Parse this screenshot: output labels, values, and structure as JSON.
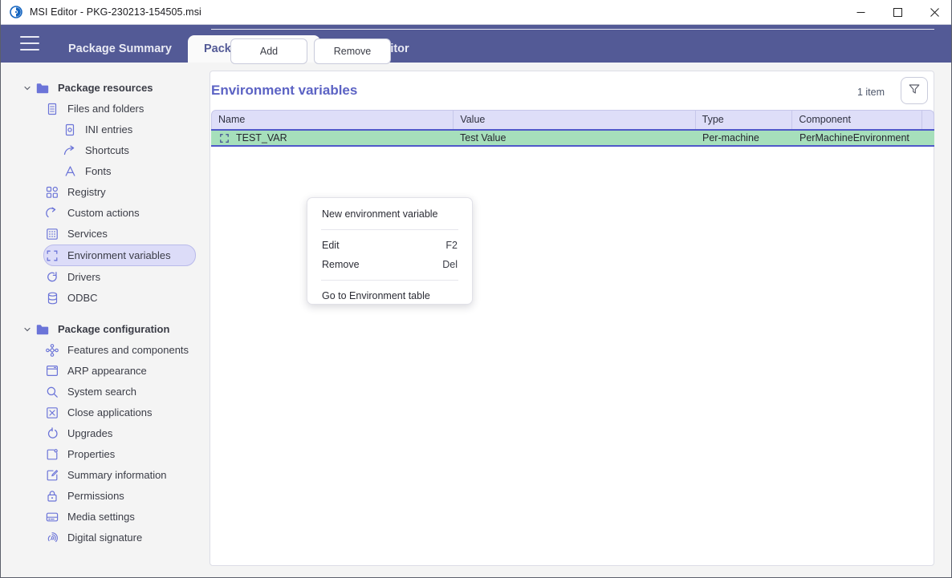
{
  "window": {
    "title": "MSI Editor - PKG-230213-154505.msi",
    "app_icon": "msi-editor-logo-icon",
    "controls": [
      {
        "name": "minimize",
        "icon": "minimize-icon"
      },
      {
        "name": "maximize",
        "icon": "maximize-icon"
      },
      {
        "name": "close",
        "icon": "close-icon"
      }
    ]
  },
  "tabbar": {
    "menu_icon": "hamburger-menu-icon",
    "tabs": [
      {
        "label": "Package Summary",
        "active": false
      },
      {
        "label": "Package Designer",
        "active": true
      },
      {
        "label": "Tables Editor",
        "active": false
      }
    ]
  },
  "sidebar": {
    "groups": [
      {
        "label": "Package resources",
        "icon": "folder-icon",
        "chevron": "chevron-down-icon",
        "items": [
          {
            "label": "Files and folders",
            "icon": "document-icon",
            "depth": 1,
            "selected": false
          },
          {
            "label": "INI entries",
            "icon": "ini-file-icon",
            "depth": 2,
            "selected": false
          },
          {
            "label": "Shortcuts",
            "icon": "shortcut-arrow-icon",
            "depth": 2,
            "selected": false
          },
          {
            "label": "Fonts",
            "icon": "font-a-icon",
            "depth": 2,
            "selected": false
          },
          {
            "label": "Registry",
            "icon": "registry-blocks-icon",
            "depth": 1,
            "selected": false
          },
          {
            "label": "Custom actions",
            "icon": "curved-arrow-icon",
            "depth": 1,
            "selected": false
          },
          {
            "label": "Services",
            "icon": "services-grid-icon",
            "depth": 1,
            "selected": false
          },
          {
            "label": "Environment variables",
            "icon": "dashed-square-icon",
            "depth": 1,
            "selected": true
          },
          {
            "label": "Drivers",
            "icon": "refresh-circle-icon",
            "depth": 1,
            "selected": false
          },
          {
            "label": "ODBC",
            "icon": "database-icon",
            "depth": 1,
            "selected": false
          }
        ]
      },
      {
        "label": "Package configuration",
        "icon": "folder-icon",
        "chevron": "chevron-down-icon",
        "items": [
          {
            "label": "Features and components",
            "icon": "components-node-icon",
            "depth": 1,
            "selected": false
          },
          {
            "label": "ARP appearance",
            "icon": "window-icon",
            "depth": 1,
            "selected": false
          },
          {
            "label": "System search",
            "icon": "search-icon",
            "depth": 1,
            "selected": false
          },
          {
            "label": "Close applications",
            "icon": "x-square-icon",
            "depth": 1,
            "selected": false
          },
          {
            "label": "Upgrades",
            "icon": "refresh-circle-icon",
            "depth": 1,
            "selected": false
          },
          {
            "label": "Properties",
            "icon": "properties-tag-icon",
            "depth": 1,
            "selected": false
          },
          {
            "label": "Summary information",
            "icon": "edit-square-icon",
            "depth": 1,
            "selected": false
          },
          {
            "label": "Permissions",
            "icon": "lock-icon",
            "depth": 1,
            "selected": false
          },
          {
            "label": "Media settings",
            "icon": "media-disk-icon",
            "depth": 1,
            "selected": false
          },
          {
            "label": "Digital signature",
            "icon": "fingerprint-icon",
            "depth": 1,
            "selected": false
          }
        ]
      }
    ]
  },
  "main": {
    "page_title": "Environment variables",
    "item_count": "1 item",
    "filter_icon": "funnel-filter-icon",
    "table": {
      "columns": [
        "Name",
        "Value",
        "Type",
        "Component"
      ],
      "rows": [
        {
          "icon": "dashed-square-icon",
          "name": "TEST_VAR",
          "value": "Test Value",
          "type": "Per-machine",
          "component": "PerMachineEnvironment",
          "selected": true
        }
      ]
    },
    "footer": {
      "add_label": "Add",
      "remove_label": "Remove"
    }
  },
  "context_menu": {
    "items": [
      {
        "label": "New environment variable",
        "shortcut": ""
      },
      {
        "separator": true
      },
      {
        "label": "Edit",
        "shortcut": "F2"
      },
      {
        "label": "Remove",
        "shortcut": "Del"
      },
      {
        "separator": true
      },
      {
        "label": "Go to Environment table",
        "shortcut": ""
      }
    ]
  },
  "colors": {
    "tabbar": "#535a96",
    "accent": "#5c63c4",
    "icon_blue": "#6b74d8",
    "selected_nav": "#dcdcf8",
    "table_header": "#dedef8",
    "row_selected_green": "#a6dfbb",
    "row_border": "#4f58c9",
    "page_bg": "#f4f4f4"
  }
}
